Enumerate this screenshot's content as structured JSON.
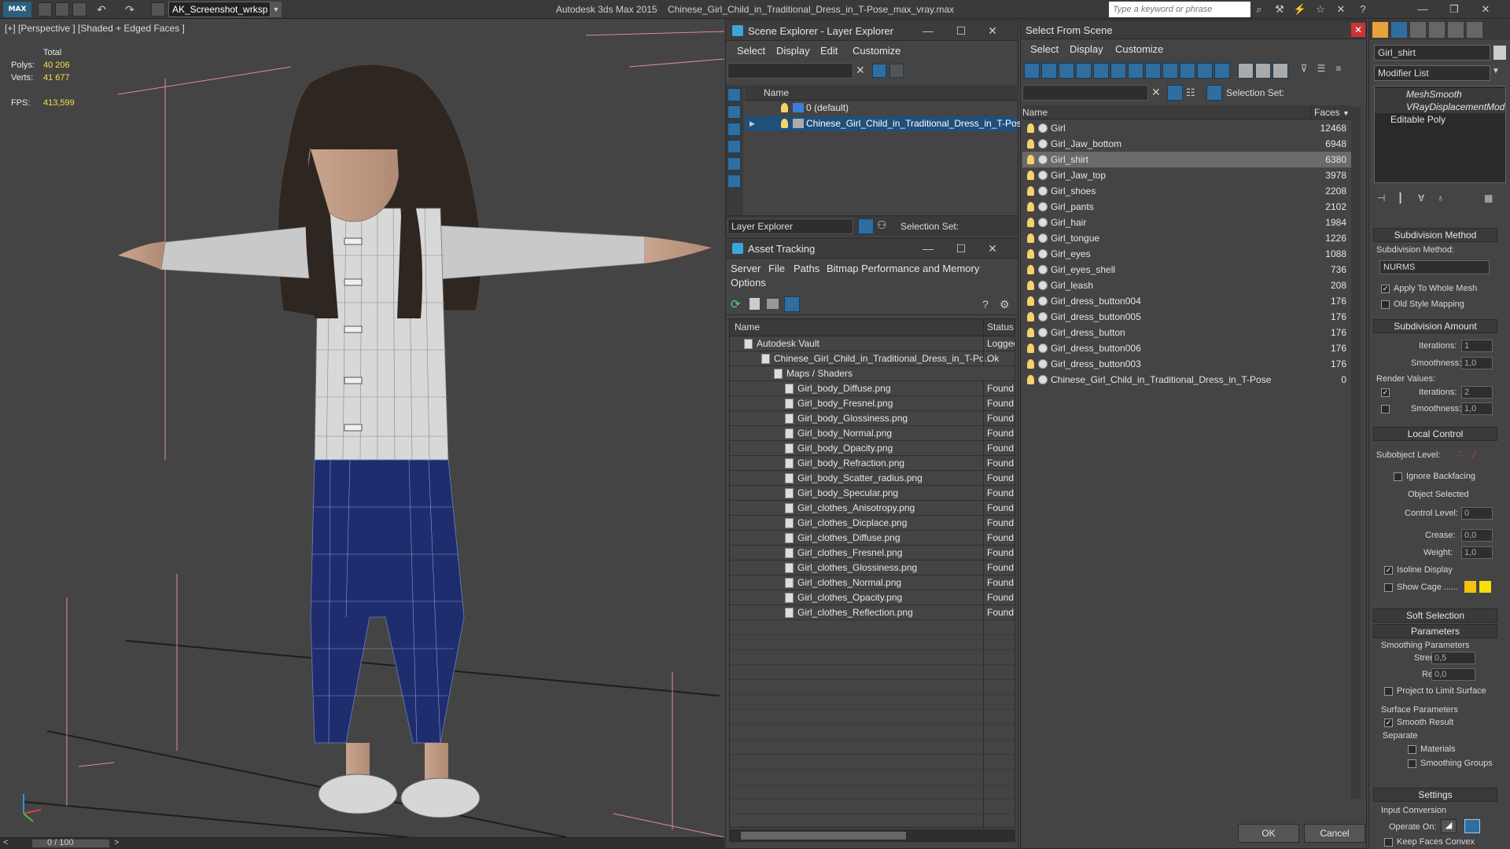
{
  "app": {
    "logo": "MAX",
    "workspace": "AK_Screenshot_wrksp",
    "title_app": "Autodesk 3ds Max  2015",
    "title_file": "Chinese_Girl_Child_in_Traditional_Dress_in_T-Pose_max_vray.max",
    "search_placeholder": "Type a keyword or phrase"
  },
  "viewport": {
    "label": "[+] [Perspective ] [Shaded + Edged Faces ]",
    "stats": {
      "total_label": "Total",
      "polys_label": "Polys:",
      "polys": "40 206",
      "verts_label": "Verts:",
      "verts": "41 677",
      "fps_label": "FPS:",
      "fps": "413,599"
    },
    "time": "0 / 100"
  },
  "scene_explorer": {
    "title": "Scene Explorer - Layer Explorer",
    "menu": [
      "Select",
      "Display",
      "Edit",
      "Customize"
    ],
    "col_name": "Name",
    "rows": [
      "0 (default)",
      "Chinese_Girl_Child_in_Traditional_Dress_in_T-Pose"
    ],
    "footer_label": "Layer Explorer",
    "selection_set_label": "Selection Set:"
  },
  "asset_tracking": {
    "title": "Asset Tracking",
    "menu": [
      "Server",
      "File",
      "Paths",
      "Bitmap Performance and Memory",
      "Options"
    ],
    "col_name": "Name",
    "col_status": "Status",
    "rows": [
      {
        "name": "Autodesk Vault",
        "status": "Logged"
      },
      {
        "name": "Chinese_Girl_Child_in_Traditional_Dress_in_T-Po...",
        "status": "Ok"
      },
      {
        "name": "Maps / Shaders",
        "status": ""
      },
      {
        "name": "Girl_body_Diffuse.png",
        "status": "Found"
      },
      {
        "name": "Girl_body_Fresnel.png",
        "status": "Found"
      },
      {
        "name": "Girl_body_Glossiness.png",
        "status": "Found"
      },
      {
        "name": "Girl_body_Normal.png",
        "status": "Found"
      },
      {
        "name": "Girl_body_Opacity.png",
        "status": "Found"
      },
      {
        "name": "Girl_body_Refraction.png",
        "status": "Found"
      },
      {
        "name": "Girl_body_Scatter_radius.png",
        "status": "Found"
      },
      {
        "name": "Girl_body_Specular.png",
        "status": "Found"
      },
      {
        "name": "Girl_clothes_Anisotropy.png",
        "status": "Found"
      },
      {
        "name": "Girl_clothes_Dicplace.png",
        "status": "Found"
      },
      {
        "name": "Girl_clothes_Diffuse.png",
        "status": "Found"
      },
      {
        "name": "Girl_clothes_Fresnel.png",
        "status": "Found"
      },
      {
        "name": "Girl_clothes_Glossiness.png",
        "status": "Found"
      },
      {
        "name": "Girl_clothes_Normal.png",
        "status": "Found"
      },
      {
        "name": "Girl_clothes_Opacity.png",
        "status": "Found"
      },
      {
        "name": "Girl_clothes_Reflection.png",
        "status": "Found"
      }
    ]
  },
  "select_from_scene": {
    "title": "Select From Scene",
    "menu": [
      "Select",
      "Display",
      "Customize"
    ],
    "selection_set_label": "Selection Set:",
    "col_name": "Name",
    "col_faces": "Faces",
    "rows": [
      {
        "name": "Girl",
        "faces": "12468"
      },
      {
        "name": "Girl_Jaw_bottom",
        "faces": "6948"
      },
      {
        "name": "Girl_shirt",
        "faces": "6380"
      },
      {
        "name": "Girl_Jaw_top",
        "faces": "3978"
      },
      {
        "name": "Girl_shoes",
        "faces": "2208"
      },
      {
        "name": "Girl_pants",
        "faces": "2102"
      },
      {
        "name": "Girl_hair",
        "faces": "1984"
      },
      {
        "name": "Girl_tongue",
        "faces": "1226"
      },
      {
        "name": "Girl_eyes",
        "faces": "1088"
      },
      {
        "name": "Girl_eyes_shell",
        "faces": "736"
      },
      {
        "name": "Girl_leash",
        "faces": "208"
      },
      {
        "name": "Girl_dress_button004",
        "faces": "176"
      },
      {
        "name": "Girl_dress_button005",
        "faces": "176"
      },
      {
        "name": "Girl_dress_button",
        "faces": "176"
      },
      {
        "name": "Girl_dress_button006",
        "faces": "176"
      },
      {
        "name": "Girl_dress_button003",
        "faces": "176"
      },
      {
        "name": "Chinese_Girl_Child_in_Traditional_Dress_in_T-Pose",
        "faces": "0"
      }
    ],
    "ok": "OK",
    "cancel": "Cancel"
  },
  "command_panel": {
    "object_name": "Girl_shirt",
    "modifier_list": "Modifier List",
    "stack": [
      "MeshSmooth",
      "VRayDisplacementMod",
      "Editable Poly"
    ],
    "subdivision_method_title": "Subdivision Method",
    "subdivision_method_label": "Subdivision Method:",
    "subdivision_method_value": "NURMS",
    "apply_whole_mesh": "Apply To Whole Mesh",
    "old_style_mapping": "Old Style Mapping",
    "subdivision_amount_title": "Subdivision Amount",
    "iterations_label": "Iterations:",
    "iterations_value": "1",
    "smoothness_label": "Smoothness:",
    "smoothness_value": "1,0",
    "render_values_label": "Render Values:",
    "render_iterations_value": "2",
    "render_smoothness_value": "1,0",
    "local_control_title": "Local Control",
    "subobject_level_label": "Subobject Level:",
    "ignore_backfacing": "Ignore Backfacing",
    "object_selected": "Object Selected",
    "control_level_label": "Control Level:",
    "control_level_value": "0",
    "crease_label": "Crease:",
    "crease_value": "0,0",
    "weight_label": "Weight:",
    "weight_value": "1,0",
    "isoline_display": "Isoline Display",
    "show_cage": "Show Cage ......",
    "soft_selection_title": "Soft Selection",
    "parameters_title": "Parameters",
    "smoothing_parameters": "Smoothing Parameters",
    "strength_label": "Strength:",
    "strength_value": "0,5",
    "relax_label": "Relax:",
    "relax_value": "0,0",
    "project_limit": "Project to Limit Surface",
    "surface_parameters": "Surface Parameters",
    "smooth_result": "Smooth Result",
    "separate_label": "Separate",
    "materials": "Materials",
    "smoothing_groups": "Smoothing Groups",
    "settings_title": "Settings",
    "input_conversion": "Input Conversion",
    "operate_on": "Operate On:",
    "keep_faces_convex": "Keep Faces Convex"
  },
  "colors": {
    "accent": "#3da5d9",
    "selection": "#1f4f7a",
    "stat_value": "#f3e047"
  }
}
